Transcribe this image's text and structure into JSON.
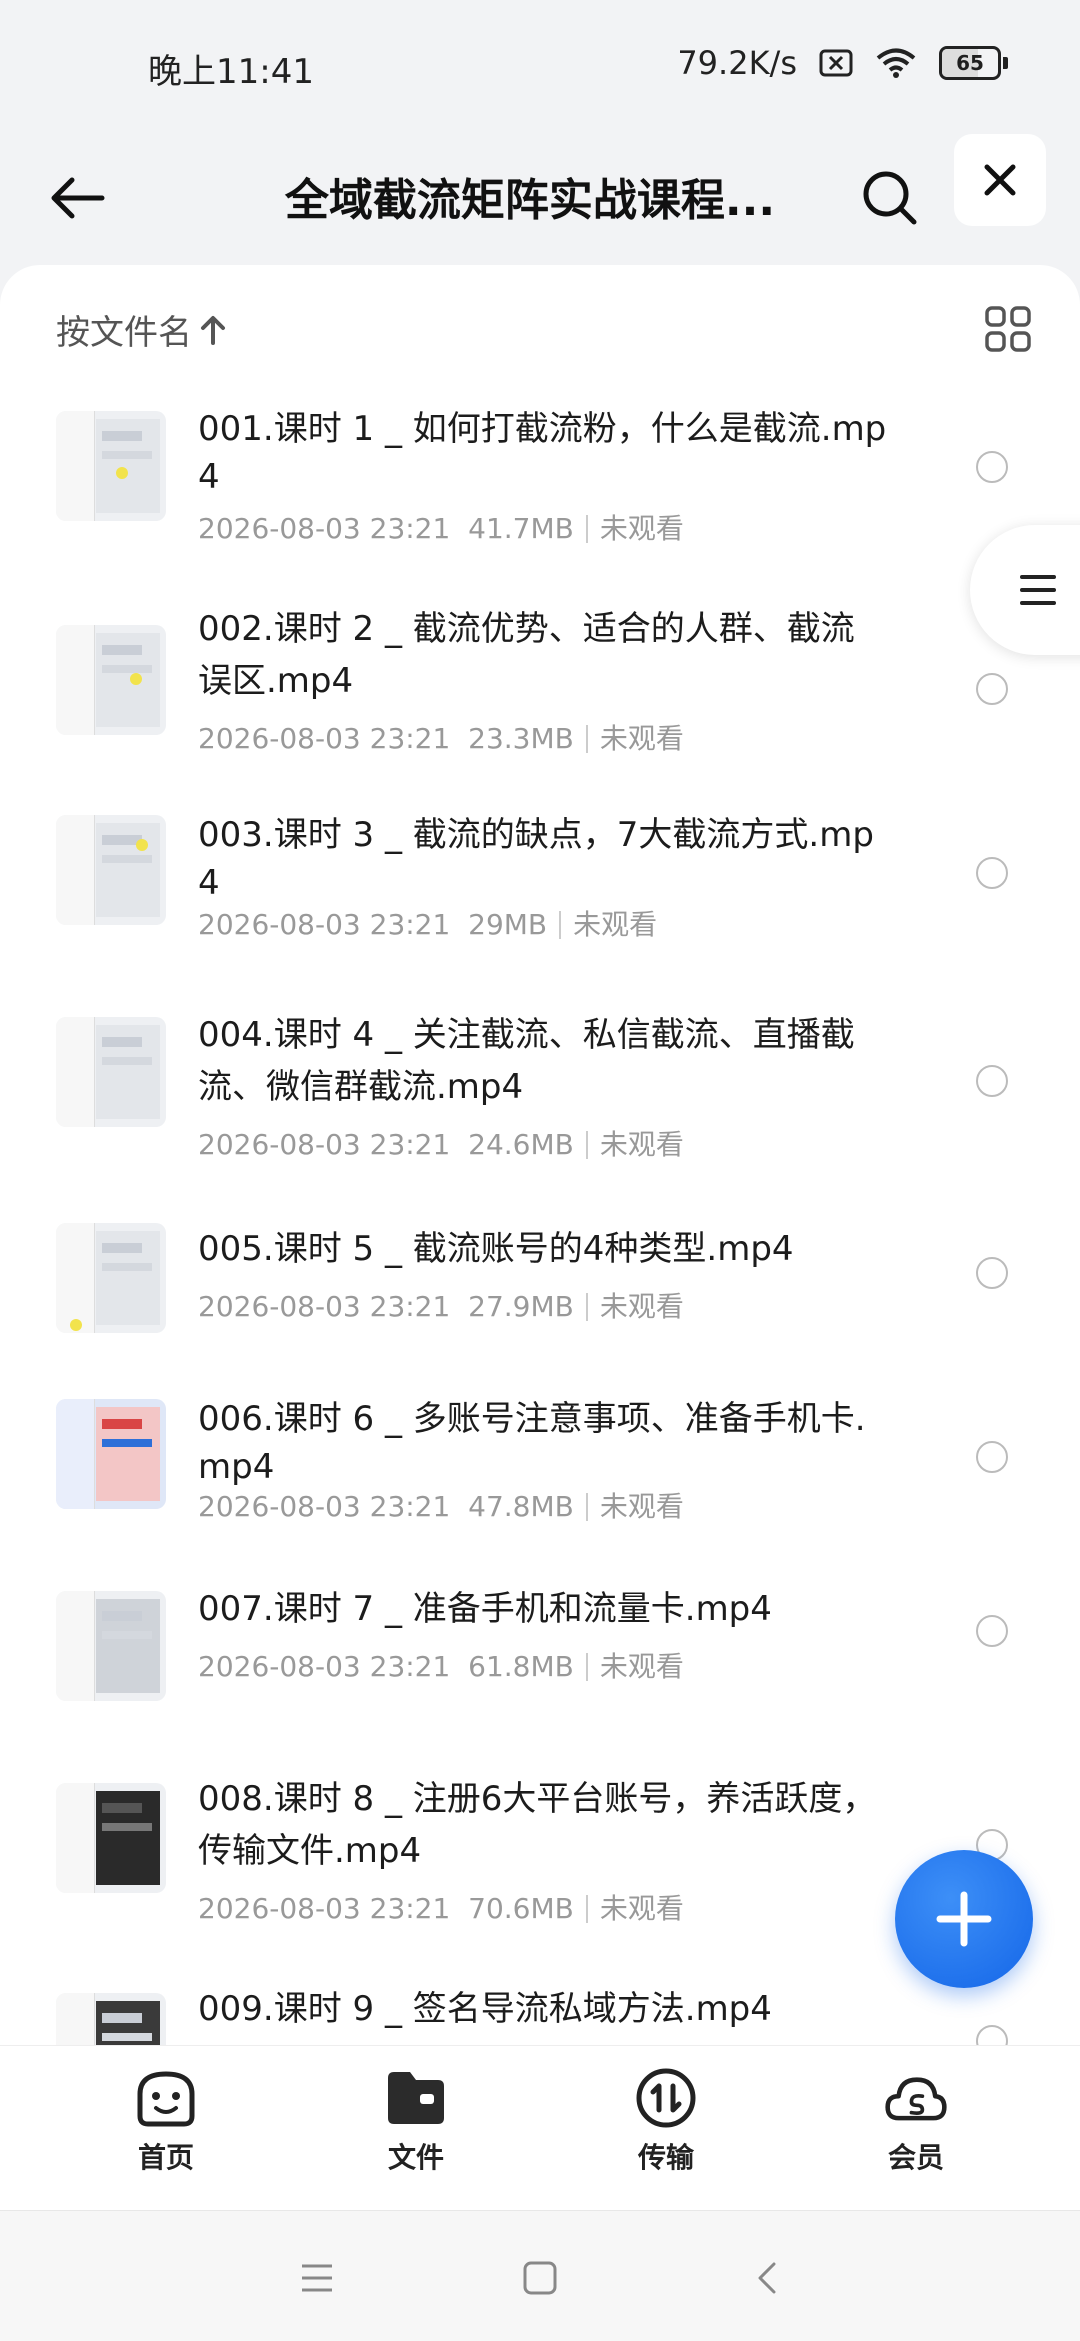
{
  "status_bar": {
    "time": "晚上11:41",
    "net_speed": "79.2K/s",
    "battery": "65"
  },
  "header": {
    "title": "全域截流矩阵实战课程..."
  },
  "sort": {
    "label": "按文件名"
  },
  "files": [
    {
      "name": "001.课时 1 _ 如何打截流粉，什么是截流.mp4",
      "date": "2026-08-03 23:21",
      "size": "41.7MB",
      "status": "未观看"
    },
    {
      "name": "002.课时 2 _ 截流优势、适合的人群、截流误区.mp4",
      "date": "2026-08-03 23:21",
      "size": "23.3MB",
      "status": "未观看"
    },
    {
      "name": "003.课时 3 _ 截流的缺点，7大截流方式.mp4",
      "date": "2026-08-03 23:21",
      "size": "29MB",
      "status": "未观看"
    },
    {
      "name": "004.课时 4 _ 关注截流、私信截流、直播截流、微信群截流.mp4",
      "date": "2026-08-03 23:21",
      "size": "24.6MB",
      "status": "未观看"
    },
    {
      "name": "005.课时 5 _ 截流账号的4种类型.mp4",
      "date": "2026-08-03 23:21",
      "size": "27.9MB",
      "status": "未观看"
    },
    {
      "name": "006.课时 6 _ 多账号注意事项、准备手机卡.mp4",
      "date": "2026-08-03 23:21",
      "size": "47.8MB",
      "status": "未观看"
    },
    {
      "name": "007.课时 7 _ 准备手机和流量卡.mp4",
      "date": "2026-08-03 23:21",
      "size": "61.8MB",
      "status": "未观看"
    },
    {
      "name": "008.课时 8 _ 注册6大平台账号，养活跃度，传输文件.mp4",
      "date": "2026-08-03 23:21",
      "size": "70.6MB",
      "status": "未观看"
    },
    {
      "name": "009.课时 9 _ 签名导流私域方法.mp4",
      "date": "",
      "size": "",
      "status": ""
    }
  ],
  "tabs": [
    {
      "label": "首页",
      "icon": "home-face-icon"
    },
    {
      "label": "文件",
      "icon": "folder-icon"
    },
    {
      "label": "传输",
      "icon": "transfer-icon"
    },
    {
      "label": "会员",
      "icon": "cloud-member-icon"
    }
  ],
  "colors": {
    "accent": "#1466e8",
    "background": "#f2f3f5"
  }
}
